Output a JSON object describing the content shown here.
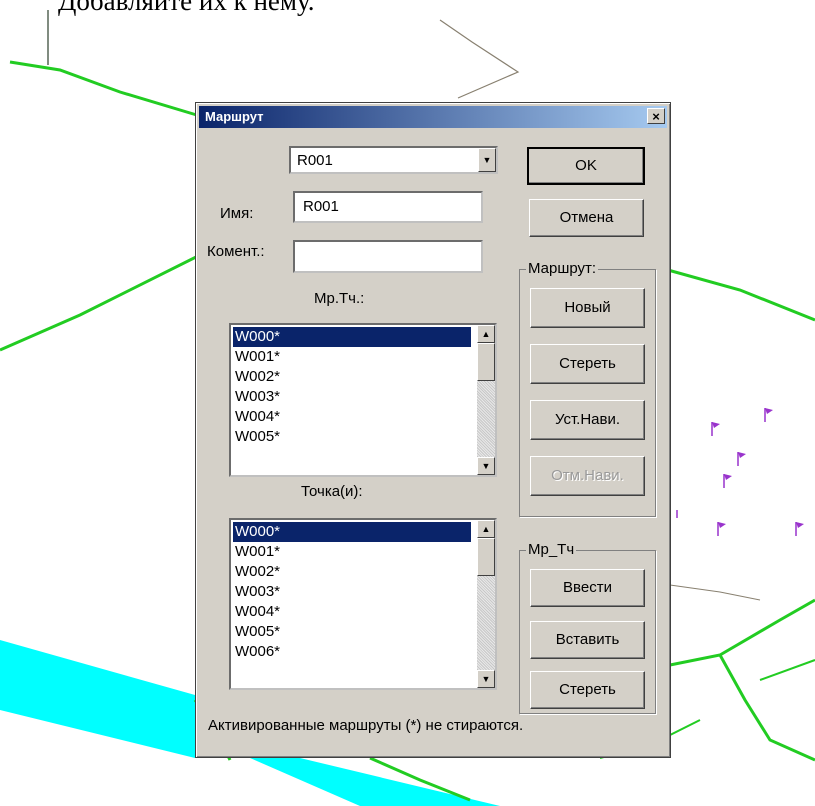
{
  "page_text": "Добавляйте их к нему.",
  "dialog": {
    "title": "Маршрут",
    "close_glyph": "×",
    "route_select": {
      "value": "R001",
      "arrow": "▼"
    },
    "name_label": "Имя:",
    "name_value": "R001",
    "comment_label": "Комент.:",
    "comment_value": "",
    "waypoints_label": "Мр.Тч.:",
    "waypoints": [
      "W000*",
      "W001*",
      "W002*",
      "W003*",
      "W004*",
      "W005*"
    ],
    "points_label": "Точка(и):",
    "points": [
      "W000*",
      "W001*",
      "W002*",
      "W003*",
      "W004*",
      "W005*",
      "W006*"
    ],
    "scroll_up": "▲",
    "scroll_down": "▼",
    "ok_label": "OK",
    "cancel_label": "Отмена",
    "route_group": {
      "legend": "Маршрут:",
      "new_label": "Новый",
      "delete_label": "Стереть",
      "set_nav_label": "Уст.Нави.",
      "cancel_nav_label": "Отм.Нави."
    },
    "wp_group": {
      "legend": "Мр_Тч",
      "enter_label": "Ввести",
      "insert_label": "Вставить",
      "delete_label": "Стереть"
    },
    "status_text": "Активированные маршруты (*) не стираются."
  },
  "colors": {
    "map_line": "#22cc22",
    "river": "#00ffff",
    "flag": "#9933cc",
    "selection": "#0a246a"
  }
}
